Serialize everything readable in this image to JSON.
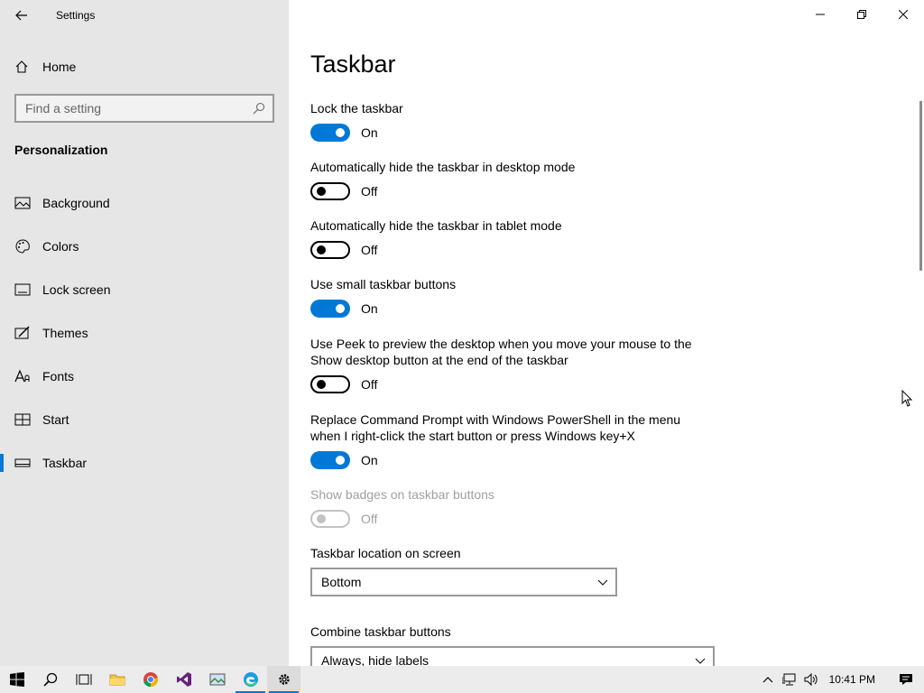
{
  "window": {
    "title": "Settings"
  },
  "sidebar": {
    "home_label": "Home",
    "search_placeholder": "Find a setting",
    "section_title": "Personalization",
    "items": [
      {
        "label": "Background",
        "icon": "image-icon"
      },
      {
        "label": "Colors",
        "icon": "palette-icon"
      },
      {
        "label": "Lock screen",
        "icon": "lock-screen-icon"
      },
      {
        "label": "Themes",
        "icon": "themes-icon"
      },
      {
        "label": "Fonts",
        "icon": "font-icon"
      },
      {
        "label": "Start",
        "icon": "start-layout-icon"
      },
      {
        "label": "Taskbar",
        "icon": "taskbar-icon",
        "selected": true
      }
    ]
  },
  "main": {
    "title": "Taskbar",
    "settings": [
      {
        "label": "Lock the taskbar",
        "state": "On"
      },
      {
        "label": "Automatically hide the taskbar in desktop mode",
        "state": "Off"
      },
      {
        "label": "Automatically hide the taskbar in tablet mode",
        "state": "Off"
      },
      {
        "label": "Use small taskbar buttons",
        "state": "On"
      },
      {
        "label": "Use Peek to preview the desktop when you move your mouse to the Show desktop button at the end of the taskbar",
        "state": "Off"
      },
      {
        "label": "Replace Command Prompt with Windows PowerShell in the menu when I right-click the start button or press Windows key+X",
        "state": "On"
      },
      {
        "label": "Show badges on taskbar buttons",
        "state": "Off",
        "disabled": true
      }
    ],
    "location_label": "Taskbar location on screen",
    "location_value": "Bottom",
    "combine_label": "Combine taskbar buttons",
    "combine_value": "Always, hide labels"
  },
  "taskbar": {
    "apps": [
      "windows-start-icon",
      "search-icon",
      "task-view-icon",
      "file-explorer-icon",
      "chrome-icon",
      "visual-studio-icon",
      "image-viewer-icon",
      "edge-icon",
      "settings-gear-icon"
    ],
    "clock": "10:41 PM"
  },
  "colors": {
    "accent": "#0078d7",
    "sidebar_bg": "#e6e6e6",
    "taskbar_bg": "#ececec"
  }
}
